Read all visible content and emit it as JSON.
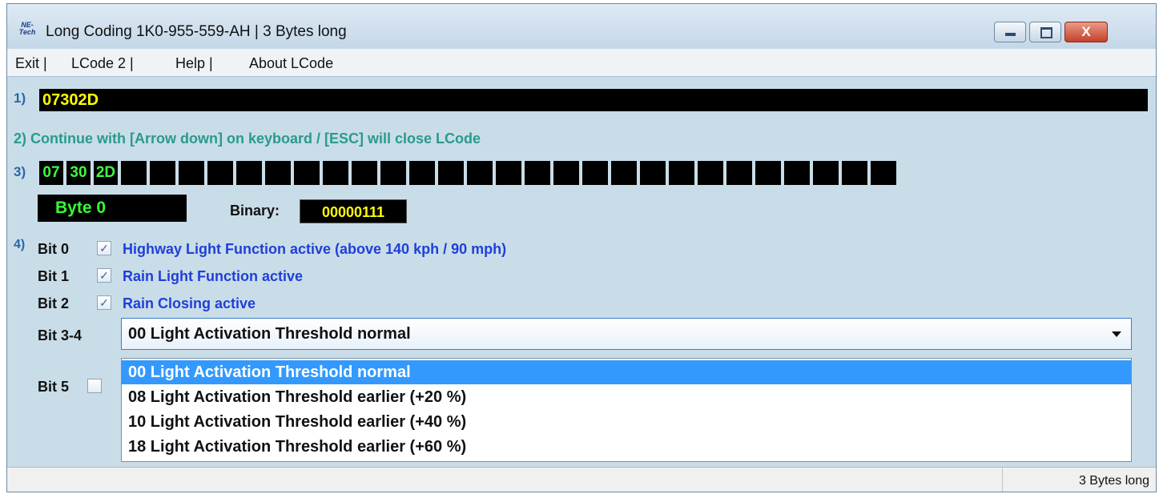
{
  "window": {
    "icon_text": "NE-Tech",
    "title": "Long Coding  1K0-955-559-AH | 3 Bytes long",
    "close_glyph": "X"
  },
  "menu": {
    "items": [
      "Exit |",
      "LCode 2 |",
      "Help |",
      "About LCode"
    ]
  },
  "step1": {
    "label": "1)",
    "code": "07302D"
  },
  "step2": {
    "label": "2) Continue with [Arrow down] on keyboard / [ESC] will close LCode"
  },
  "step3": {
    "label": "3)",
    "bytes": [
      "07",
      "30",
      "2D"
    ],
    "empty_cells": 27
  },
  "byte_info": {
    "byte_label": "Byte 0",
    "binary_label": "Binary:",
    "binary_value": "00000111"
  },
  "step4": {
    "label": "4)",
    "bits": [
      {
        "bit": "Bit 0",
        "checked": true,
        "desc": "Highway Light Function active (above 140 kph / 90 mph)"
      },
      {
        "bit": "Bit 1",
        "checked": true,
        "desc": "Rain Light Function active"
      },
      {
        "bit": "Bit 2",
        "checked": true,
        "desc": "Rain Closing active"
      }
    ],
    "combo": {
      "bit": "Bit 3-4",
      "selected": "00 Light Activation Threshold normal",
      "options": [
        "00 Light Activation Threshold normal",
        "08 Light Activation Threshold earlier (+20 %)",
        "10 Light Activation Threshold earlier (+40 %)",
        "18 Light Activation Threshold earlier (+60 %)"
      ]
    },
    "bit5": {
      "bit": "Bit 5",
      "checked": false
    }
  },
  "status": {
    "text": "3 Bytes long"
  },
  "colors": {
    "field_bg": "#000000",
    "code_text": "#ffff00",
    "byte_text": "#3cff3c",
    "desc_text": "#1f3fd9",
    "hint_text": "#2a9a8e",
    "selected_option": "#3399ff"
  }
}
